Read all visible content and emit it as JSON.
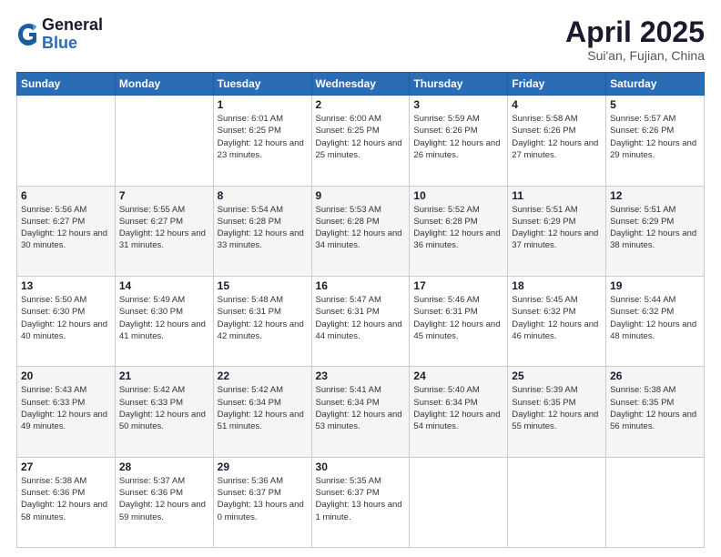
{
  "logo": {
    "general": "General",
    "blue": "Blue"
  },
  "header": {
    "title": "April 2025",
    "location": "Sui'an, Fujian, China"
  },
  "weekdays": [
    "Sunday",
    "Monday",
    "Tuesday",
    "Wednesday",
    "Thursday",
    "Friday",
    "Saturday"
  ],
  "weeks": [
    [
      {
        "day": "",
        "sunrise": "",
        "sunset": "",
        "daylight": ""
      },
      {
        "day": "",
        "sunrise": "",
        "sunset": "",
        "daylight": ""
      },
      {
        "day": "1",
        "sunrise": "Sunrise: 6:01 AM",
        "sunset": "Sunset: 6:25 PM",
        "daylight": "Daylight: 12 hours and 23 minutes."
      },
      {
        "day": "2",
        "sunrise": "Sunrise: 6:00 AM",
        "sunset": "Sunset: 6:25 PM",
        "daylight": "Daylight: 12 hours and 25 minutes."
      },
      {
        "day": "3",
        "sunrise": "Sunrise: 5:59 AM",
        "sunset": "Sunset: 6:26 PM",
        "daylight": "Daylight: 12 hours and 26 minutes."
      },
      {
        "day": "4",
        "sunrise": "Sunrise: 5:58 AM",
        "sunset": "Sunset: 6:26 PM",
        "daylight": "Daylight: 12 hours and 27 minutes."
      },
      {
        "day": "5",
        "sunrise": "Sunrise: 5:57 AM",
        "sunset": "Sunset: 6:26 PM",
        "daylight": "Daylight: 12 hours and 29 minutes."
      }
    ],
    [
      {
        "day": "6",
        "sunrise": "Sunrise: 5:56 AM",
        "sunset": "Sunset: 6:27 PM",
        "daylight": "Daylight: 12 hours and 30 minutes."
      },
      {
        "day": "7",
        "sunrise": "Sunrise: 5:55 AM",
        "sunset": "Sunset: 6:27 PM",
        "daylight": "Daylight: 12 hours and 31 minutes."
      },
      {
        "day": "8",
        "sunrise": "Sunrise: 5:54 AM",
        "sunset": "Sunset: 6:28 PM",
        "daylight": "Daylight: 12 hours and 33 minutes."
      },
      {
        "day": "9",
        "sunrise": "Sunrise: 5:53 AM",
        "sunset": "Sunset: 6:28 PM",
        "daylight": "Daylight: 12 hours and 34 minutes."
      },
      {
        "day": "10",
        "sunrise": "Sunrise: 5:52 AM",
        "sunset": "Sunset: 6:28 PM",
        "daylight": "Daylight: 12 hours and 36 minutes."
      },
      {
        "day": "11",
        "sunrise": "Sunrise: 5:51 AM",
        "sunset": "Sunset: 6:29 PM",
        "daylight": "Daylight: 12 hours and 37 minutes."
      },
      {
        "day": "12",
        "sunrise": "Sunrise: 5:51 AM",
        "sunset": "Sunset: 6:29 PM",
        "daylight": "Daylight: 12 hours and 38 minutes."
      }
    ],
    [
      {
        "day": "13",
        "sunrise": "Sunrise: 5:50 AM",
        "sunset": "Sunset: 6:30 PM",
        "daylight": "Daylight: 12 hours and 40 minutes."
      },
      {
        "day": "14",
        "sunrise": "Sunrise: 5:49 AM",
        "sunset": "Sunset: 6:30 PM",
        "daylight": "Daylight: 12 hours and 41 minutes."
      },
      {
        "day": "15",
        "sunrise": "Sunrise: 5:48 AM",
        "sunset": "Sunset: 6:31 PM",
        "daylight": "Daylight: 12 hours and 42 minutes."
      },
      {
        "day": "16",
        "sunrise": "Sunrise: 5:47 AM",
        "sunset": "Sunset: 6:31 PM",
        "daylight": "Daylight: 12 hours and 44 minutes."
      },
      {
        "day": "17",
        "sunrise": "Sunrise: 5:46 AM",
        "sunset": "Sunset: 6:31 PM",
        "daylight": "Daylight: 12 hours and 45 minutes."
      },
      {
        "day": "18",
        "sunrise": "Sunrise: 5:45 AM",
        "sunset": "Sunset: 6:32 PM",
        "daylight": "Daylight: 12 hours and 46 minutes."
      },
      {
        "day": "19",
        "sunrise": "Sunrise: 5:44 AM",
        "sunset": "Sunset: 6:32 PM",
        "daylight": "Daylight: 12 hours and 48 minutes."
      }
    ],
    [
      {
        "day": "20",
        "sunrise": "Sunrise: 5:43 AM",
        "sunset": "Sunset: 6:33 PM",
        "daylight": "Daylight: 12 hours and 49 minutes."
      },
      {
        "day": "21",
        "sunrise": "Sunrise: 5:42 AM",
        "sunset": "Sunset: 6:33 PM",
        "daylight": "Daylight: 12 hours and 50 minutes."
      },
      {
        "day": "22",
        "sunrise": "Sunrise: 5:42 AM",
        "sunset": "Sunset: 6:34 PM",
        "daylight": "Daylight: 12 hours and 51 minutes."
      },
      {
        "day": "23",
        "sunrise": "Sunrise: 5:41 AM",
        "sunset": "Sunset: 6:34 PM",
        "daylight": "Daylight: 12 hours and 53 minutes."
      },
      {
        "day": "24",
        "sunrise": "Sunrise: 5:40 AM",
        "sunset": "Sunset: 6:34 PM",
        "daylight": "Daylight: 12 hours and 54 minutes."
      },
      {
        "day": "25",
        "sunrise": "Sunrise: 5:39 AM",
        "sunset": "Sunset: 6:35 PM",
        "daylight": "Daylight: 12 hours and 55 minutes."
      },
      {
        "day": "26",
        "sunrise": "Sunrise: 5:38 AM",
        "sunset": "Sunset: 6:35 PM",
        "daylight": "Daylight: 12 hours and 56 minutes."
      }
    ],
    [
      {
        "day": "27",
        "sunrise": "Sunrise: 5:38 AM",
        "sunset": "Sunset: 6:36 PM",
        "daylight": "Daylight: 12 hours and 58 minutes."
      },
      {
        "day": "28",
        "sunrise": "Sunrise: 5:37 AM",
        "sunset": "Sunset: 6:36 PM",
        "daylight": "Daylight: 12 hours and 59 minutes."
      },
      {
        "day": "29",
        "sunrise": "Sunrise: 5:36 AM",
        "sunset": "Sunset: 6:37 PM",
        "daylight": "Daylight: 13 hours and 0 minutes."
      },
      {
        "day": "30",
        "sunrise": "Sunrise: 5:35 AM",
        "sunset": "Sunset: 6:37 PM",
        "daylight": "Daylight: 13 hours and 1 minute."
      },
      {
        "day": "",
        "sunrise": "",
        "sunset": "",
        "daylight": ""
      },
      {
        "day": "",
        "sunrise": "",
        "sunset": "",
        "daylight": ""
      },
      {
        "day": "",
        "sunrise": "",
        "sunset": "",
        "daylight": ""
      }
    ]
  ]
}
